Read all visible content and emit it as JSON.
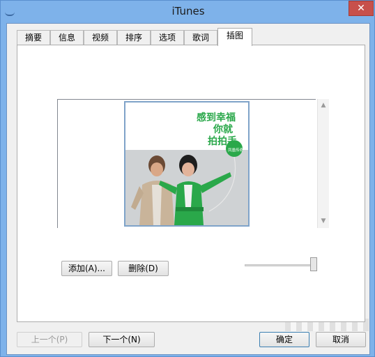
{
  "window": {
    "title": "iTunes",
    "close_glyph": "✕"
  },
  "tabs": [
    {
      "label": "摘要"
    },
    {
      "label": "信息"
    },
    {
      "label": "视频"
    },
    {
      "label": "排序"
    },
    {
      "label": "选项"
    },
    {
      "label": "歌词"
    },
    {
      "label": "插图"
    }
  ],
  "artwork": {
    "slogan_lines": [
      "感到幸福",
      "你就",
      "拍拍手"
    ],
    "badge_text": "凤凰传奇"
  },
  "buttons": {
    "add": "添加(A)...",
    "delete": "删除(D)",
    "previous": "上一个(P)",
    "next": "下一个(N)",
    "ok": "确定",
    "cancel": "取消"
  },
  "scroll": {
    "up": "▲",
    "down": "▼"
  }
}
